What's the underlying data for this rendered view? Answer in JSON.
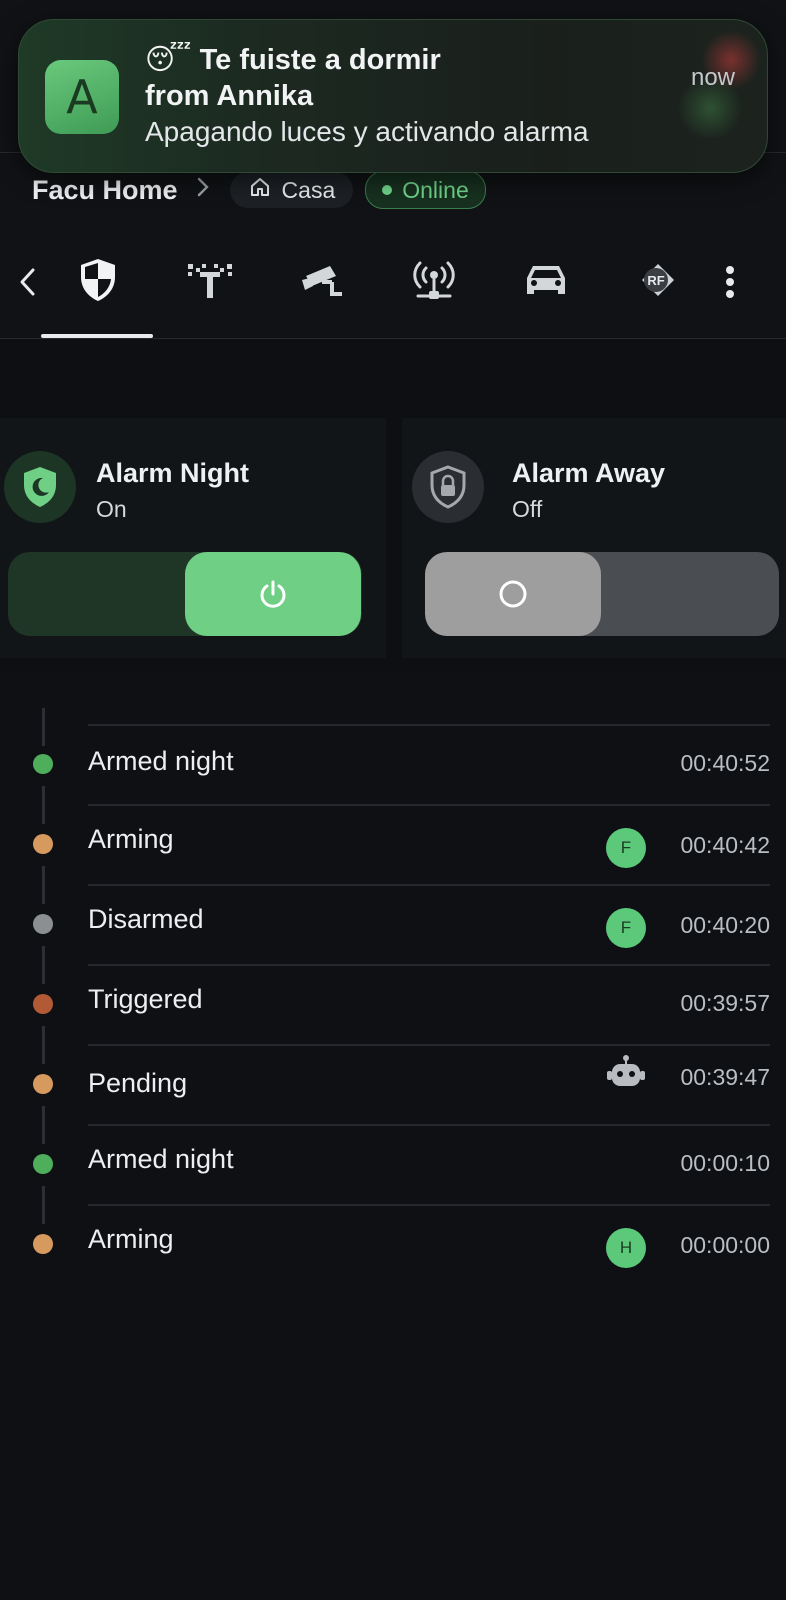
{
  "notification": {
    "emoji": "😴",
    "title": "Te fuiste a dormir",
    "from": "from Annika",
    "body": "Apagando luces y activando alarma",
    "time": "now",
    "app_letter": "A"
  },
  "header": {
    "home_name": "Facu Home",
    "chip_location": "Casa",
    "chip_status": "Online"
  },
  "tabs": [
    {
      "icon": "security-shield-icon",
      "active": true
    },
    {
      "icon": "motion-sensor-icon",
      "active": false
    },
    {
      "icon": "cctv-camera-icon",
      "active": false
    },
    {
      "icon": "access-point-network-icon",
      "active": false
    },
    {
      "icon": "car-icon",
      "active": false
    },
    {
      "icon": "rf-remote-icon",
      "active": false
    }
  ],
  "cards": [
    {
      "title": "Alarm Night",
      "state": "On",
      "icon": "shield-moon-icon",
      "on": true,
      "accent": "#6fcf85"
    },
    {
      "title": "Alarm Away",
      "state": "Off",
      "icon": "shield-lock-icon",
      "on": false,
      "accent": "#9e9e9e"
    }
  ],
  "timeline": [
    {
      "label": "Armed night",
      "time": "00:40:52",
      "dot": "#4fae5c",
      "avatar": ""
    },
    {
      "label": "Arming",
      "time": "00:40:42",
      "dot": "#d69a5e",
      "avatar": "F"
    },
    {
      "label": "Disarmed",
      "time": "00:40:20",
      "dot": "#8c8f92",
      "avatar": "F"
    },
    {
      "label": "Triggered",
      "time": "00:39:57",
      "dot": "#b25a36",
      "avatar": ""
    },
    {
      "label": "Pending",
      "time": "00:39:47",
      "dot": "#d69a5e",
      "avatar": "robot"
    },
    {
      "label": "Armed night",
      "time": "00:00:10",
      "dot": "#4fae5c",
      "avatar": ""
    },
    {
      "label": "Arming",
      "time": "00:00:00",
      "dot": "#d69a5e",
      "avatar": "H"
    }
  ]
}
